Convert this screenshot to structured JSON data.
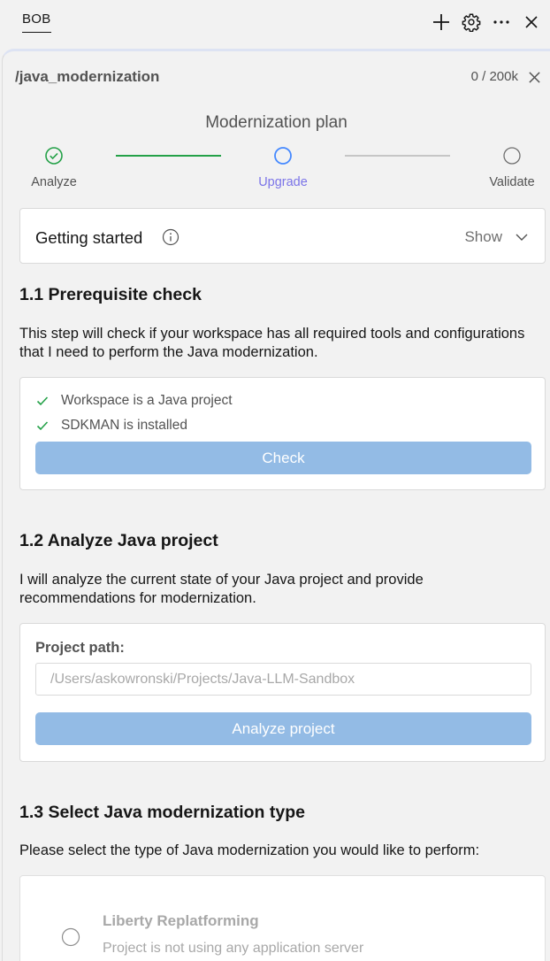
{
  "topbar": {
    "tab_label": "BOB",
    "icons": [
      "plus-icon",
      "gear-icon",
      "more-icon",
      "close-icon"
    ]
  },
  "panel": {
    "command": "/java_modernization",
    "token_count": "0 / 200k"
  },
  "plan": {
    "title": "Modernization plan",
    "steps": [
      {
        "label": "Analyze",
        "state": "complete"
      },
      {
        "label": "Upgrade",
        "state": "active"
      },
      {
        "label": "Validate",
        "state": "pending"
      }
    ]
  },
  "getting_started": {
    "title": "Getting started",
    "toggle_label": "Show"
  },
  "prereq": {
    "heading": "1.1 Prerequisite check",
    "description": "This step will check if your workspace has all required tools and configurations that I need to perform the Java modernization.",
    "checks": [
      "Workspace is a Java project",
      "SDKMAN is installed"
    ],
    "button_label": "Check"
  },
  "analyze": {
    "heading": "1.2 Analyze Java project",
    "description": "I will analyze the current state of your Java project and provide recommendations for modernization.",
    "path_label": "Project path:",
    "path_placeholder": "/Users/askowronski/Projects/Java-LLM-Sandbox",
    "button_label": "Analyze project"
  },
  "select_type": {
    "heading": "1.3 Select Java modernization type",
    "description": "Please select the type of Java modernization you would like to perform:",
    "options": [
      {
        "title": "Liberty Replatforming",
        "description": "Project is not using any application server"
      }
    ]
  },
  "colors": {
    "complete": "#24a148",
    "active_step": "#7b74e8",
    "button": "#93bbe5",
    "pending": "#525252"
  }
}
